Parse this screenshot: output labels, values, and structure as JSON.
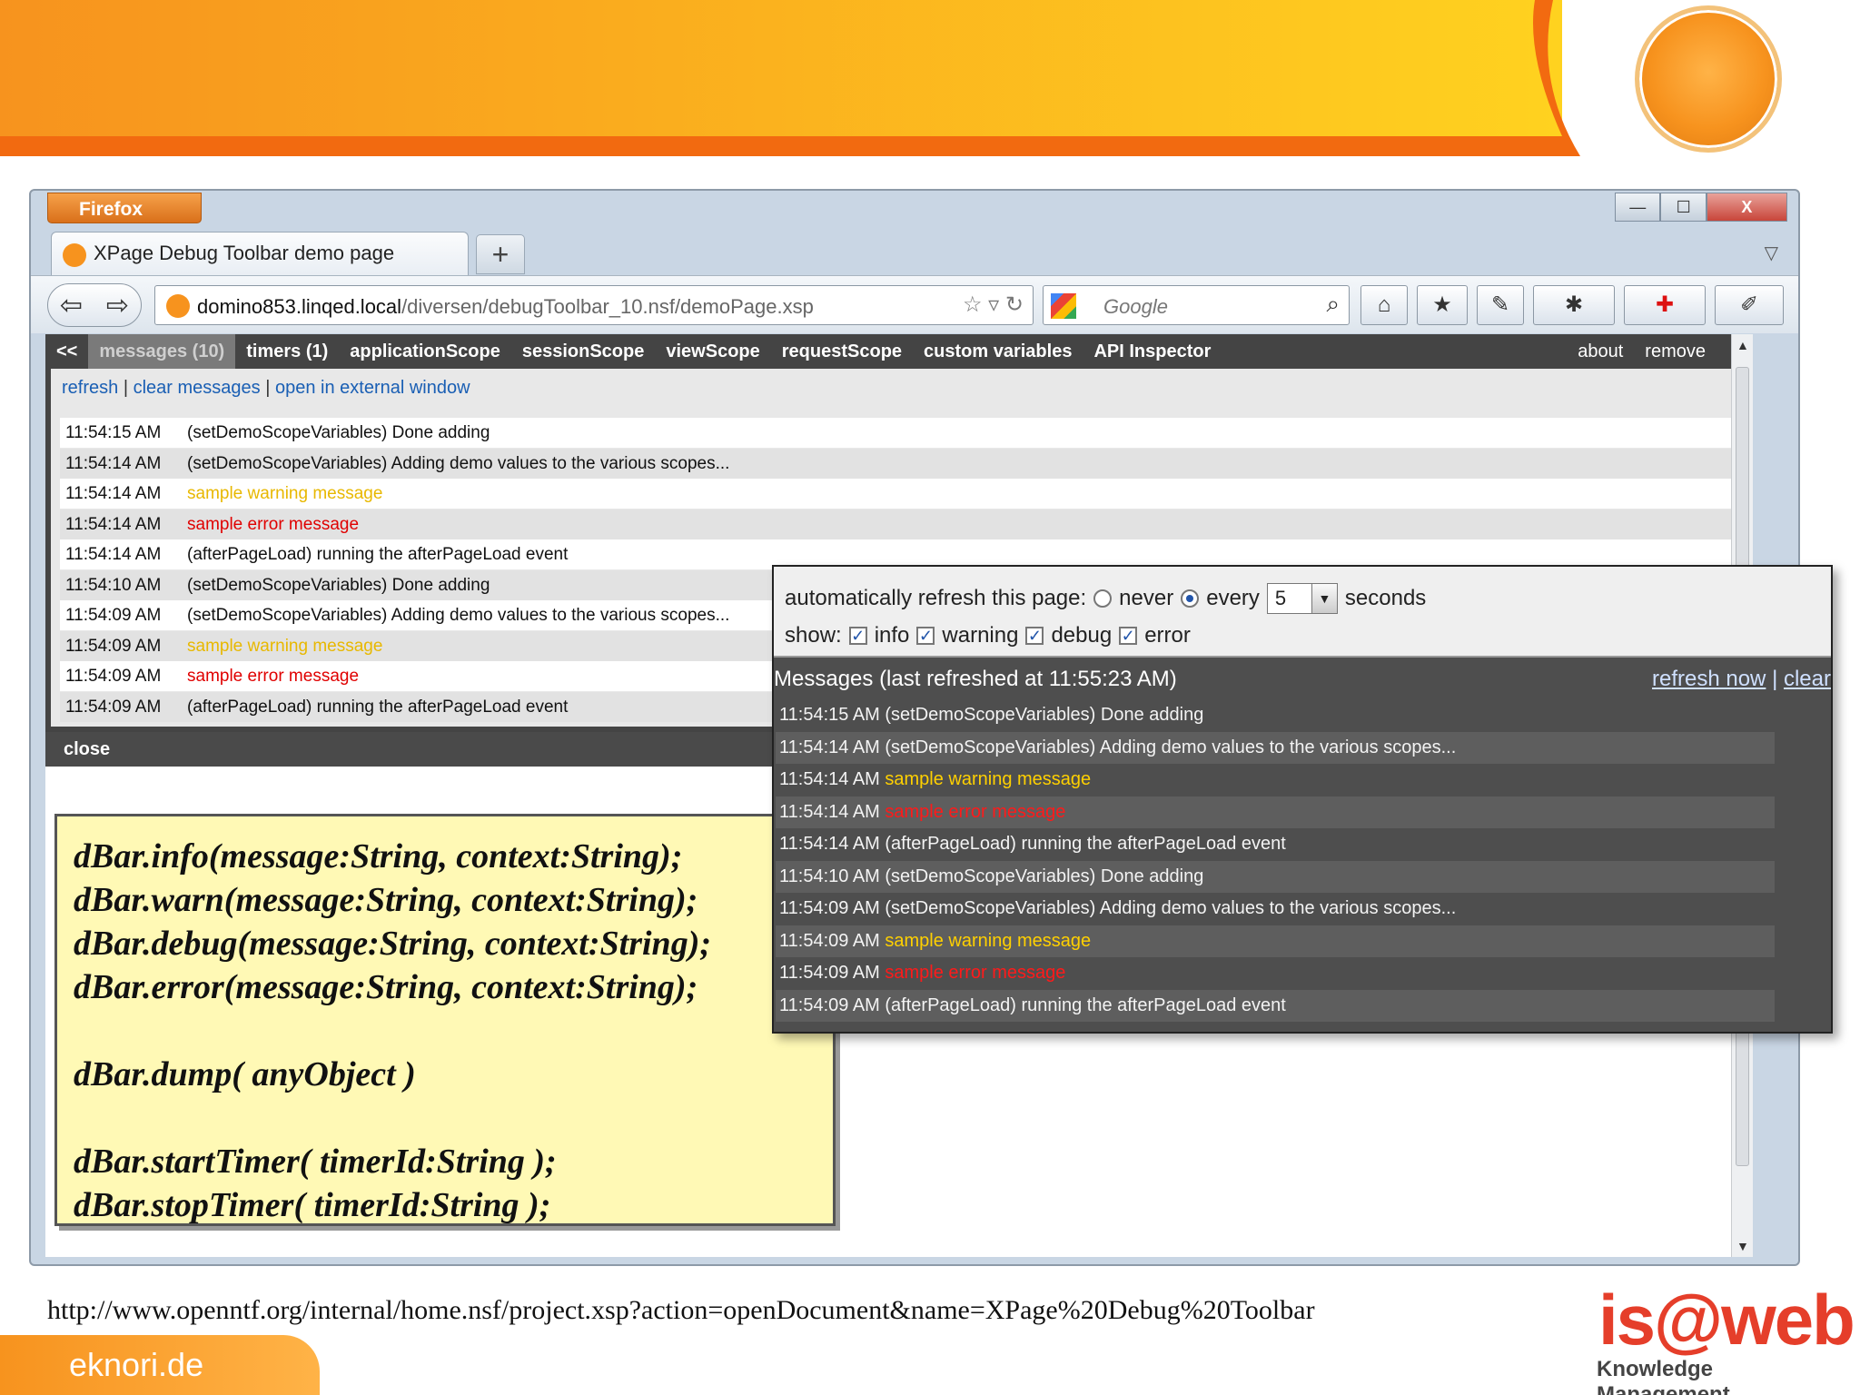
{
  "browser": {
    "app_button": "Firefox",
    "tab_title": "XPage Debug Toolbar demo page",
    "new_tab": "+",
    "url_host": "domino853.linqed.local",
    "url_path": "/diversen/debugToolbar_10.nsf/demoPage.xsp",
    "search_placeholder": "Google",
    "window_controls": [
      "—",
      "☐",
      "X"
    ]
  },
  "debug_toolbar": {
    "collapse": "<<",
    "tabs": [
      "messages (10)",
      "timers (1)",
      "applicationScope",
      "sessionScope",
      "viewScope",
      "requestScope",
      "custom variables",
      "API Inspector"
    ],
    "right_links": [
      "about",
      "remove"
    ],
    "links": [
      "refresh",
      "clear messages",
      "open in external window"
    ],
    "link_separator": "|",
    "close": "close",
    "messages": [
      {
        "time": "11:54:15 AM",
        "text": "(setDemoScopeVariables) Done adding",
        "level": "info"
      },
      {
        "time": "11:54:14 AM",
        "text": "(setDemoScopeVariables) Adding demo values to the various scopes...",
        "level": "info"
      },
      {
        "time": "11:54:14 AM",
        "text": "sample warning message",
        "level": "warn"
      },
      {
        "time": "11:54:14 AM",
        "text": "sample error message",
        "level": "error"
      },
      {
        "time": "11:54:14 AM",
        "text": "(afterPageLoad) running the afterPageLoad event",
        "level": "info"
      },
      {
        "time": "11:54:10 AM",
        "text": "(setDemoScopeVariables) Done adding",
        "level": "info"
      },
      {
        "time": "11:54:09 AM",
        "text": "(setDemoScopeVariables) Adding demo values to the various scopes...",
        "level": "info"
      },
      {
        "time": "11:54:09 AM",
        "text": "sample warning message",
        "level": "warn"
      },
      {
        "time": "11:54:09 AM",
        "text": "sample error message",
        "level": "error"
      },
      {
        "time": "11:54:09 AM",
        "text": "(afterPageLoad) running the afterPageLoad event",
        "level": "info"
      }
    ]
  },
  "code_box": {
    "lines_a": [
      "dBar.info(message:String, context:String);",
      "dBar.warn(message:String, context:String);",
      "dBar.debug(message:String, context:String);",
      "dBar.error(message:String, context:String);"
    ],
    "line_b": "dBar.dump( anyObject )",
    "lines_c": [
      "dBar.startTimer( timerId:String );",
      "dBar.stopTimer( timerId:String );"
    ]
  },
  "external_window": {
    "refresh_label": "automatically refresh this page:",
    "never": "never",
    "every": "every",
    "interval": "5",
    "seconds": "seconds",
    "show_label": "show:",
    "filters": [
      "info",
      "warning",
      "debug",
      "error"
    ],
    "messages_title": "Messages",
    "last_refreshed": "(last refreshed at 11:55:23 AM)",
    "refresh_now": "refresh now",
    "separator": "|",
    "clear": "clear"
  },
  "footer": {
    "url": "http://www.openntf.org/internal/home.nsf/project.xsp?action=openDocument&name=XPage%20Debug%20Toolbar",
    "site": "eknori.de",
    "logo_text": "is@web",
    "logo_sub": "Knowledge Management"
  },
  "colors": {
    "banner_orange": "#f7931e",
    "banner_yellow": "#ffd21f",
    "warn": "#e8b800",
    "error": "#e00000",
    "link": "#1a5fb4"
  }
}
